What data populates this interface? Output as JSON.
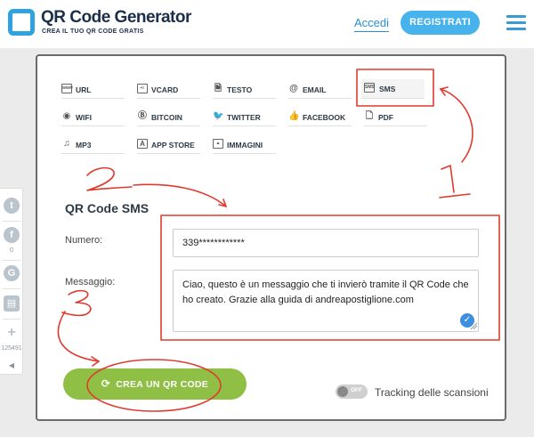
{
  "header": {
    "title": "QR Code Generator",
    "subtitle": "CREA IL TUO QR CODE GRATIS",
    "login": "Accedi",
    "register": "REGISTRATI"
  },
  "types": [
    {
      "label": "URL",
      "icon": "url-icon"
    },
    {
      "label": "VCARD",
      "icon": "vcard-icon"
    },
    {
      "label": "TESTO",
      "icon": "text-icon"
    },
    {
      "label": "EMAIL",
      "icon": "email-icon"
    },
    {
      "label": "SMS",
      "icon": "sms-icon"
    },
    {
      "label": "WIFI",
      "icon": "wifi-icon"
    },
    {
      "label": "BITCOIN",
      "icon": "bitcoin-icon"
    },
    {
      "label": "TWITTER",
      "icon": "twitter-icon"
    },
    {
      "label": "FACEBOOK",
      "icon": "facebook-icon"
    },
    {
      "label": "PDF",
      "icon": "pdf-icon"
    },
    {
      "label": "MP3",
      "icon": "mp3-icon"
    },
    {
      "label": "APP STORE",
      "icon": "app-store-icon"
    },
    {
      "label": "IMMAGINI",
      "icon": "images-icon"
    }
  ],
  "form": {
    "section_title": "QR Code SMS",
    "number_label": "Numero:",
    "number_value": "339************",
    "message_label": "Messaggio:",
    "message_value": "Ciao, questo è un messaggio che ti invierò tramite il QR Code che ho creato. Grazie alla guida di andreapostiglione.com",
    "create_button": "CREA UN QR CODE",
    "toggle_state": "OFF",
    "tracking_label": "Tracking delle scansioni"
  },
  "share": {
    "count_facebook": "0",
    "count_total": "125491"
  },
  "annotations": {
    "step1": "1",
    "step2": "2",
    "step3": "3",
    "color": "#e03a2f"
  },
  "colors": {
    "brand": "#2fa3e0",
    "register_bg": "#47b3ec",
    "create_bg": "#8fc045",
    "active_type": "SMS"
  }
}
